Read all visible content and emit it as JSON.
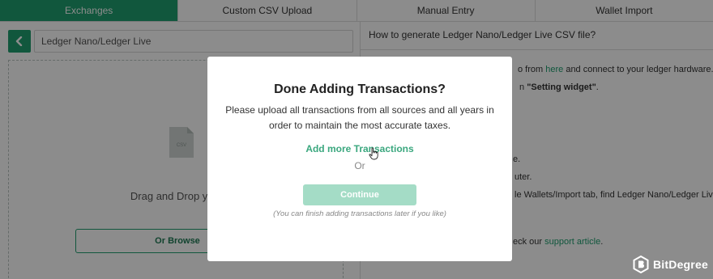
{
  "tabs": [
    {
      "label": "Exchanges",
      "active": true
    },
    {
      "label": "Custom CSV Upload",
      "active": false
    },
    {
      "label": "Manual Entry",
      "active": false
    },
    {
      "label": "Wallet Import",
      "active": false
    }
  ],
  "left": {
    "back_icon": "chevron-left-icon",
    "exchange_value": "Ledger Nano/Ledger Live",
    "file_icon_label": "CSV",
    "drag_text": "Drag and Drop your",
    "browse_label": "Or Browse"
  },
  "right": {
    "title": "How to generate Ledger Nano/Ledger Live CSV file?",
    "lines": [
      {
        "pre": "o from ",
        "link": "here",
        "post": " and connect to your ledger hardware."
      },
      {
        "pre": "n ",
        "bold": "\"Setting widget\"",
        "post": "."
      },
      {
        "text": "e."
      },
      {
        "text": "uter."
      },
      {
        "text": "le Wallets/Import tab, find Ledger Nano/Ledger Live,"
      },
      {
        "pre": "eck our ",
        "link": "support article",
        "post": "."
      }
    ]
  },
  "modal": {
    "title": "Done Adding Transactions?",
    "body": "Please upload all transactions from all sources and all years in order to maintain the most accurate taxes.",
    "add_more": "Add more Transactions",
    "or": "Or",
    "continue": "Continue",
    "hint": "(You can finish adding transactions later if you like)"
  },
  "watermark": {
    "text": "BitDegree"
  },
  "colors": {
    "brand_green": "#1f9e6f",
    "continue_disabled": "#a4dcc6",
    "overlay": "rgba(0,0,0,0.45)"
  }
}
